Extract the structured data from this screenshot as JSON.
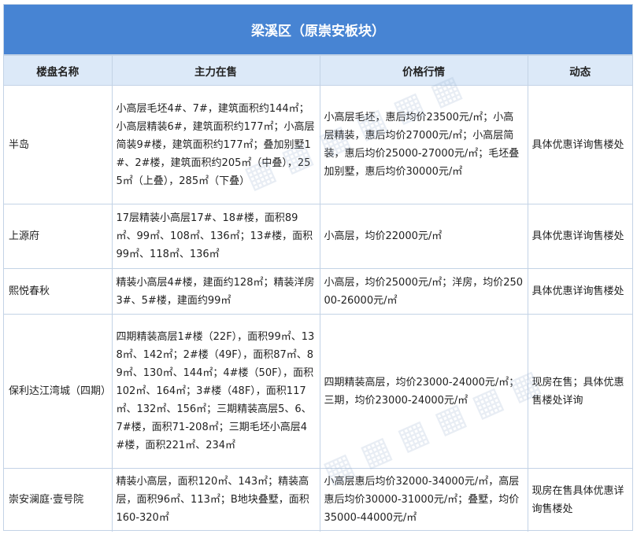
{
  "title": "梁溪区（原崇安板块）",
  "headers": [
    "楼盘名称",
    "主力在售",
    "价格行情",
    "动态"
  ],
  "rows": [
    {
      "name": "半岛",
      "main": "小高层毛坯4#、7#，建筑面积约144㎡；小高层精装6#，建筑面积约177㎡；小高层简装9#楼，建筑面积约177㎡；叠加别墅1#、2#楼，建筑面积约205㎡（中叠），255㎡（上叠），285㎡（下叠）",
      "price": "小高层毛坯，惠后均价23500元/㎡；小高层精装，惠后均价27000元/㎡；小高层简装，惠后均价25000-27000元/㎡；毛坯叠加别墅，惠后均价30000元/㎡",
      "status": "具体优惠详询售楼处"
    },
    {
      "name": "上源府",
      "main": "17层精装小高层17#、18#楼，面积89㎡、99㎡、108㎡、136㎡；13#楼，面积99㎡、118㎡、136㎡",
      "price": "小高层，均价22000元/㎡",
      "status": "具体优惠详询售楼处"
    },
    {
      "name": "熙悦春秋",
      "main": "精装小高层4#楼，建面约128㎡；精装洋房3#、5#楼，建面约99㎡",
      "price": "小高层，均价25000元/㎡；洋房，均价25000-26000元/㎡",
      "status": "具体优惠详询售楼处"
    },
    {
      "name": "保利达江湾城（四期）",
      "main": "四期精装高层1#楼（22F），面积99㎡、138㎡、142㎡；2#楼（49F），面积87㎡、89㎡、130㎡、144㎡；4#楼（50F），面积102㎡、164㎡；3#楼（48F），面积117㎡、132㎡、156㎡；三期精装高层5、6、7#楼，面积71-208㎡；三期毛坯小高层4#楼，面积221㎡、234㎡",
      "price": "四期精装高层，均价23000-24000元/㎡；三期，均价23000-24000元/㎡",
      "status": "现房在售；具体优惠售楼处详询"
    },
    {
      "name": "崇安澜庭·壹号院",
      "main": "精装小高层，面积120㎡、143㎡；精装高层，面积96㎡、113㎡；B地块叠墅，面积160-320㎡",
      "price": "小高层惠后均价32000-34000元/㎡，高层惠后均价30000-31000元/㎡；叠墅，均价35000-44000元/㎡",
      "status": "现房在售具体优惠详询售楼处"
    }
  ]
}
